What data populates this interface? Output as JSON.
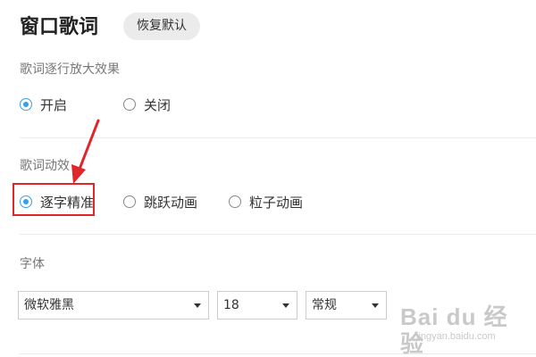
{
  "header": {
    "title": "窗口歌词",
    "restore_label": "恢复默认"
  },
  "zoom_effect": {
    "label": "歌词逐行放大效果",
    "options": [
      {
        "label": "开启",
        "checked": true
      },
      {
        "label": "关闭",
        "checked": false
      }
    ]
  },
  "animation": {
    "label": "歌词动效",
    "options": [
      {
        "label": "逐字精准",
        "checked": true
      },
      {
        "label": "跳跃动画",
        "checked": false
      },
      {
        "label": "粒子动画",
        "checked": false
      }
    ]
  },
  "font": {
    "label": "字体",
    "family": "微软雅黑",
    "size": "18",
    "style": "常规"
  },
  "watermark": {
    "main": "Bai du 经验",
    "sub": "jingyan.baidu.com"
  },
  "colors": {
    "accent": "#35a0ea",
    "annotation_red": "#e0262b"
  }
}
